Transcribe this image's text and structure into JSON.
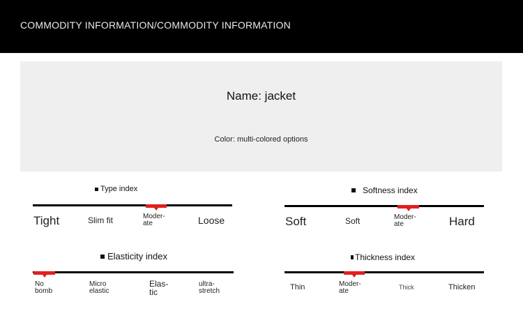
{
  "header": {
    "title": "COMMODITY INFORMATION/COMMODITY INFORMATION"
  },
  "product": {
    "name": "Name: jacket",
    "color": "Color: multi-colored options"
  },
  "indices": {
    "type": {
      "title": "Type index",
      "labels": [
        "Tight",
        "Slim fit",
        "Moder-\nate",
        "Loose"
      ],
      "selected": "Moder-\nate",
      "selected_position": 0.62
    },
    "softness": {
      "title": "Softness index",
      "labels": [
        "Soft",
        "Soft",
        "Moder-\nate",
        "Hard"
      ],
      "selected": "Moder-\nate",
      "selected_position": 0.62
    },
    "elasticity": {
      "title": "Elasticity index",
      "labels": [
        "No\nbomb",
        "Micro\nelastic",
        "Elas-\ntic",
        "ultra-\nstretch"
      ],
      "selected": "No\nbomb",
      "selected_position": 0.05
    },
    "thickness": {
      "title": "Thickness index",
      "labels": [
        "Thin",
        "Moder-\nate",
        "Thick",
        "Thicken"
      ],
      "selected": "Moder-\nate",
      "selected_position": 0.35
    }
  },
  "colors": {
    "header_bg": "#000000",
    "panel_bg": "#efefef",
    "marker": "#e02020"
  }
}
